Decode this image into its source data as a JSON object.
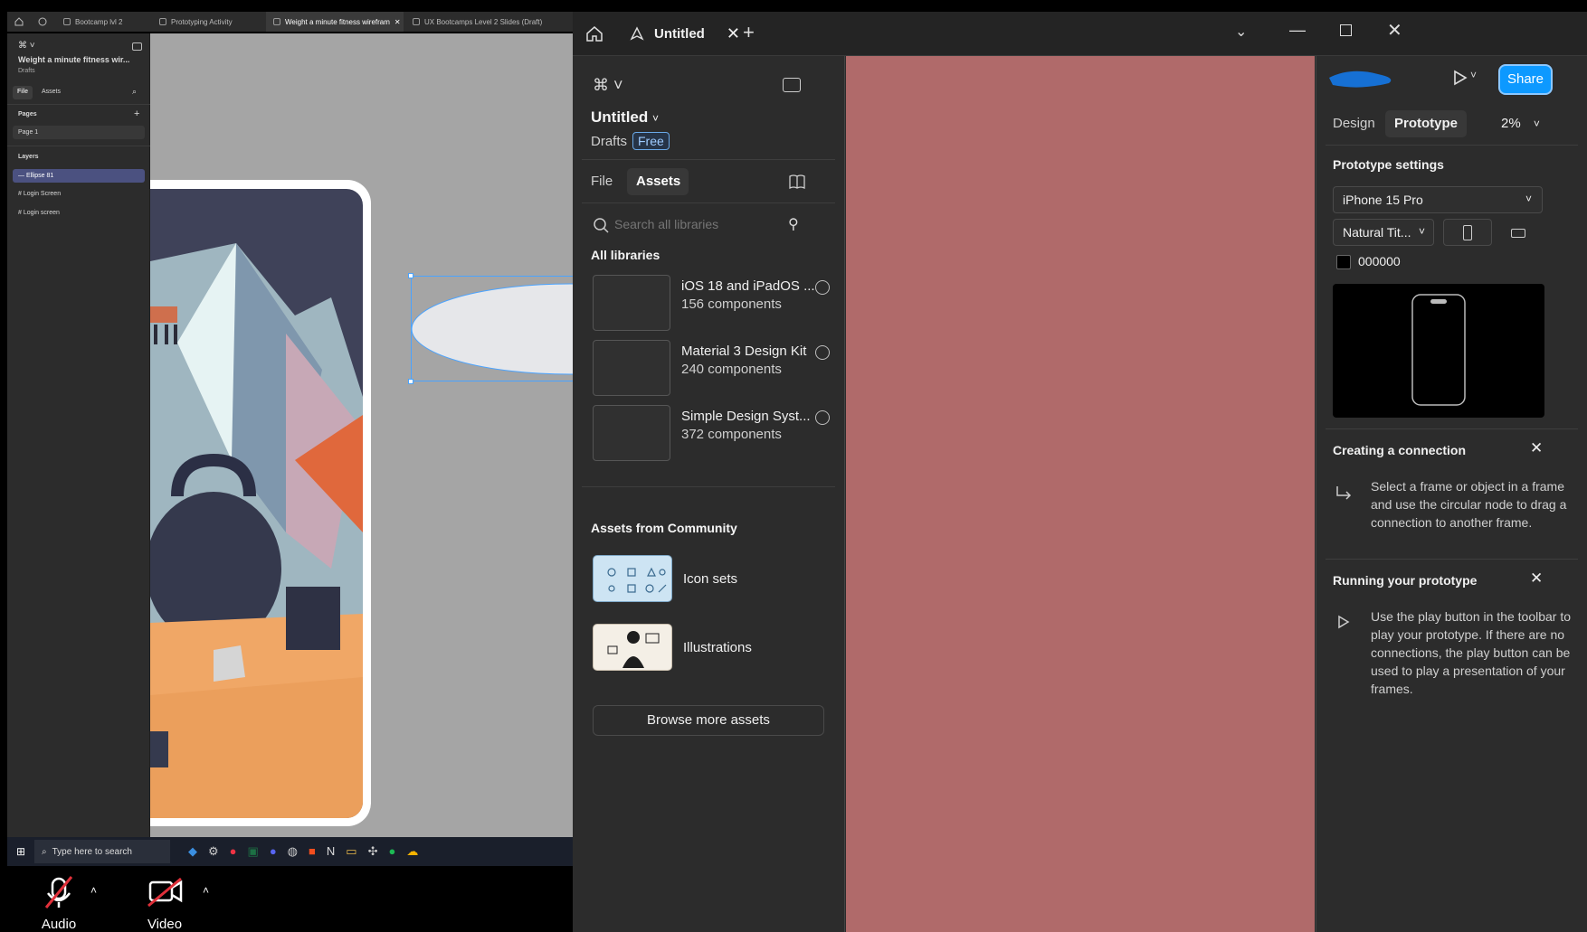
{
  "left_window": {
    "tabs": [
      "Bootcamp lvl 2",
      "Prototyping Activity",
      "Weight a minute fitness wirefram",
      "UX Bootcamps Level 2 Slides (Draft)"
    ],
    "file_title": "Weight a minute fitness wir...",
    "drafts_label": "Drafts",
    "file_tab": "File",
    "assets_tab": "Assets",
    "pages_label": "Pages",
    "page_1": "Page 1",
    "layers_label": "Layers",
    "layers": [
      "Ellipse 81",
      "Login Screen",
      "Login screen"
    ],
    "taskbar_search": "Type here to search"
  },
  "meeting_bar": {
    "audio_label": "Audio",
    "video_label": "Video"
  },
  "right_window": {
    "tab_title": "Untitled",
    "file_name": "Untitled",
    "drafts_label": "Drafts",
    "plan_badge": "Free",
    "file_tab": "File",
    "assets_tab": "Assets",
    "search_placeholder": "Search all libraries",
    "all_libraries_label": "All libraries",
    "libraries": [
      {
        "name": "iOS 18 and iPadOS ...",
        "count": "156 components"
      },
      {
        "name": "Material 3 Design Kit",
        "count": "240 components"
      },
      {
        "name": "Simple Design Syst...",
        "count": "372 components"
      }
    ],
    "community_label": "Assets from Community",
    "community_items": [
      "Icon sets",
      "Illustrations"
    ],
    "browse_more": "Browse more assets",
    "share_label": "Share",
    "design_tab": "Design",
    "prototype_tab": "Prototype",
    "zoom": "2%",
    "prototype_settings_label": "Prototype settings",
    "device": "iPhone 15 Pro",
    "device_model": "Natural Tit...",
    "bg_hex": "000000",
    "tip1_title": "Creating a connection",
    "tip1_body": "Select a frame or object in a frame and use the circular node to drag a connection to another frame.",
    "tip2_title": "Running your prototype",
    "tip2_body": "Use the play button in the toolbar to play your prototype. If there are no connections, the play button can be used to play a presentation of your frames."
  },
  "colors": {
    "canvas_fill": "#b06a6a",
    "accent_blue": "#0d99ff",
    "panel": "#2c2c2c"
  }
}
